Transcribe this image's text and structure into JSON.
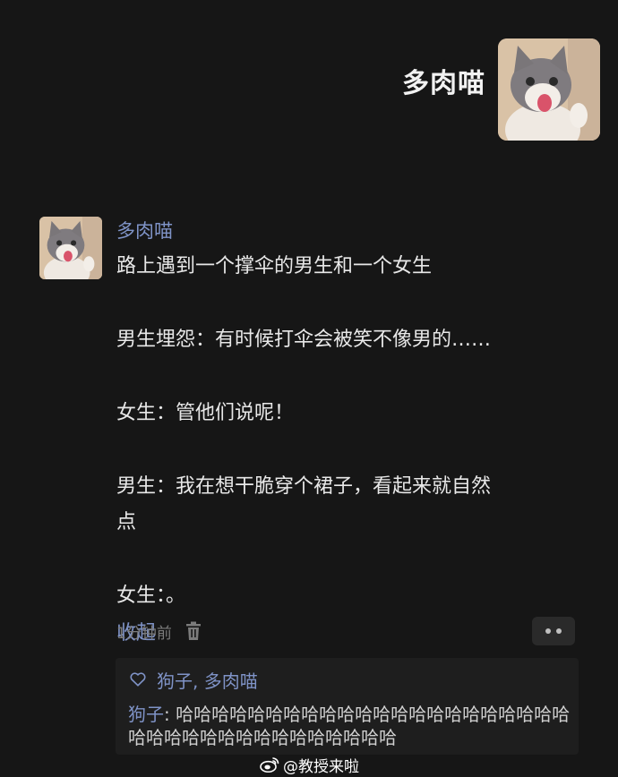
{
  "header": {
    "name": "多肉喵",
    "avatar_icon": "cat-avatar"
  },
  "post": {
    "author": "多肉喵",
    "lines": [
      "路上遇到一个撑伞的男生和一个女生",
      "男生埋怨：有时候打伞会被笑不像男的……",
      "女生：管他们说呢！",
      "男生：我在想干脆穿个裙子，看起来就自然",
      "点",
      "女生：。"
    ],
    "collapse_label": "收起"
  },
  "meta": {
    "time": "1分钟前",
    "delete_icon": "trash-icon",
    "more_icon": "more-dots-icon"
  },
  "likes": {
    "icon": "heart-icon",
    "text": "狗子, 多肉喵"
  },
  "reply": {
    "name": "狗子",
    "separator": ": ",
    "text": "哈哈哈哈哈哈哈哈哈哈哈哈哈哈哈哈哈哈哈哈哈哈哈哈哈哈哈哈哈哈哈哈哈哈哈哈哈"
  },
  "watermark": {
    "icon": "weibo-icon",
    "text": "@教授来啦"
  },
  "colors": {
    "background": "#161616",
    "accent": "#7f93c7",
    "text": "#e8e8e8",
    "muted": "#7b7b7b"
  }
}
